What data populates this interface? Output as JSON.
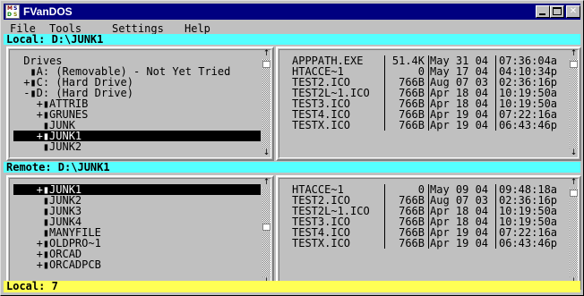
{
  "app": {
    "title": "FVanDOS",
    "icon_letters": [
      "M",
      "S",
      "D",
      "S"
    ]
  },
  "window_buttons": {
    "minimize": "minimize",
    "maximize": "maximize",
    "close": "✕"
  },
  "menu": [
    "File",
    "Tools",
    "Settings",
    "Help"
  ],
  "local": {
    "path_label": "Local: D:\\JUNK1",
    "tree": [
      {
        "prefix": " ",
        "text": "Drives",
        "selected": false,
        "indent": 0
      },
      {
        "prefix": " ",
        "text": "▮A: (Removable) - Not Yet Tried",
        "selected": false,
        "indent": 1
      },
      {
        "prefix": "+",
        "text": "▮C: (Hard Drive)",
        "selected": false,
        "indent": 1
      },
      {
        "prefix": "-",
        "text": "▮D: (Hard Drive)",
        "selected": false,
        "indent": 1
      },
      {
        "prefix": "+",
        "text": "▮ATTRIB",
        "selected": false,
        "indent": 2
      },
      {
        "prefix": "+",
        "text": "▮GRUNES",
        "selected": false,
        "indent": 2
      },
      {
        "prefix": " ",
        "text": "▮JUNK",
        "selected": false,
        "indent": 2
      },
      {
        "prefix": "+",
        "text": "▮JUNK1",
        "selected": true,
        "indent": 2
      },
      {
        "prefix": " ",
        "text": "▮JUNK2",
        "selected": false,
        "indent": 2
      }
    ],
    "files": [
      {
        "name": "APPPATH.EXE",
        "size": "51.4K",
        "date": "May 31 04",
        "time": "07:36:04a"
      },
      {
        "name": "HTACCE~1",
        "size": "0",
        "date": "May 17 04",
        "time": "04:10:34p"
      },
      {
        "name": "TEST2.ICO",
        "size": "766B",
        "date": "Aug 07 03",
        "time": "02:36:16p"
      },
      {
        "name": "TEST2L~1.ICO",
        "size": "766B",
        "date": "Apr 18 04",
        "time": "10:19:50a"
      },
      {
        "name": "TEST3.ICO",
        "size": "766B",
        "date": "Apr 18 04",
        "time": "10:19:50a"
      },
      {
        "name": "TEST4.ICO",
        "size": "766B",
        "date": "Apr 19 04",
        "time": "07:22:16a"
      },
      {
        "name": "TESTX.ICO",
        "size": "766B",
        "date": "Apr 19 04",
        "time": "06:43:46p"
      }
    ]
  },
  "remote": {
    "path_label": "Remote: D:\\JUNK1",
    "tree": [
      {
        "prefix": "+",
        "text": "▮JUNK1",
        "selected": true,
        "indent": 2
      },
      {
        "prefix": " ",
        "text": "▮JUNK2",
        "selected": false,
        "indent": 2
      },
      {
        "prefix": " ",
        "text": "▮JUNK3",
        "selected": false,
        "indent": 2
      },
      {
        "prefix": " ",
        "text": "▮JUNK4",
        "selected": false,
        "indent": 2
      },
      {
        "prefix": " ",
        "text": "▮MANYFILE",
        "selected": false,
        "indent": 2
      },
      {
        "prefix": "+",
        "text": "▮OLDPRO~1",
        "selected": false,
        "indent": 2
      },
      {
        "prefix": "+",
        "text": "▮ORCAD",
        "selected": false,
        "indent": 2
      },
      {
        "prefix": "+",
        "text": "▮ORCADPCB",
        "selected": false,
        "indent": 2
      }
    ],
    "files": [
      {
        "name": "HTACCE~1",
        "size": "0",
        "date": "May 09 04",
        "time": "09:48:18a"
      },
      {
        "name": "TEST2.ICO",
        "size": "766B",
        "date": "Aug 07 03",
        "time": "02:36:16p"
      },
      {
        "name": "TEST2L~1.ICO",
        "size": "766B",
        "date": "Apr 18 04",
        "time": "10:19:50a"
      },
      {
        "name": "TEST3.ICO",
        "size": "766B",
        "date": "Apr 18 04",
        "time": "10:19:50a"
      },
      {
        "name": "TEST4.ICO",
        "size": "766B",
        "date": "Apr 19 04",
        "time": "07:22:16a"
      },
      {
        "name": "TESTX.ICO",
        "size": "766B",
        "date": "Apr 19 04",
        "time": "06:43:46p"
      }
    ]
  },
  "status": {
    "text": "Local: 7"
  },
  "scroll_icons": {
    "up": "↑",
    "down": "↓"
  },
  "colors": {
    "titlebar": "#000080",
    "pathbar": "#55ffff",
    "statusbar": "#ffff55",
    "background": "#c0c0c0"
  }
}
